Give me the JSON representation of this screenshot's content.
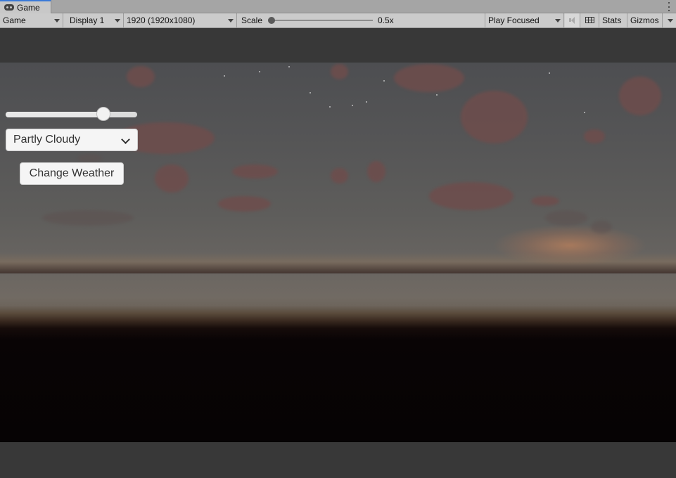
{
  "window": {
    "tab_label": "Game",
    "tab_icon": "gamepad-icon"
  },
  "toolbar": {
    "view_mode": "Game",
    "display": "Display 1",
    "resolution": "1920 (1920x1080)",
    "scale_label": "Scale",
    "scale_value": "0.5x",
    "play_mode": "Play Focused",
    "stats_label": "Stats",
    "gizmos_label": "Gizmos",
    "sound_icon": "speaker-icon",
    "keyboard_icon": "keyboard-icon"
  },
  "game_ui": {
    "slider_value_fraction": 0.77,
    "weather_selected": "Partly Cloudy",
    "change_button_label": "Change Weather"
  },
  "colors": {
    "tab_accent": "#3a79d8",
    "toolbar_bg": "#cbcbcb",
    "editor_bg": "#383838"
  }
}
